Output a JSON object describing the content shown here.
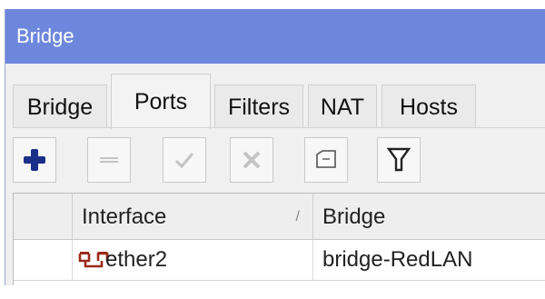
{
  "window": {
    "title": "Bridge"
  },
  "tabs": [
    {
      "label": "Bridge",
      "active": false
    },
    {
      "label": "Ports",
      "active": true
    },
    {
      "label": "Filters",
      "active": false
    },
    {
      "label": "NAT",
      "active": false
    },
    {
      "label": "Hosts",
      "active": false
    }
  ],
  "toolbar": {
    "buttons": [
      {
        "icon": "plus-icon",
        "color": "#1a2f8a"
      },
      {
        "icon": "minus-icon"
      },
      {
        "icon": "check-icon"
      },
      {
        "icon": "x-icon"
      },
      {
        "icon": "comment-icon"
      },
      {
        "icon": "filter-icon"
      }
    ]
  },
  "table": {
    "columns": [
      {
        "label": ""
      },
      {
        "label": "Interface",
        "sort_mark": "/"
      },
      {
        "label": "Bridge"
      }
    ],
    "rows": [
      {
        "interface": "ether2",
        "bridge": "bridge-RedLAN",
        "icon": "ethernet-port-icon",
        "icon_color": "#9b2a1c"
      }
    ]
  },
  "colors": {
    "titlebar": "#6d87dc",
    "accent_plus": "#1a2f8a",
    "port_icon": "#9b2a1c"
  }
}
